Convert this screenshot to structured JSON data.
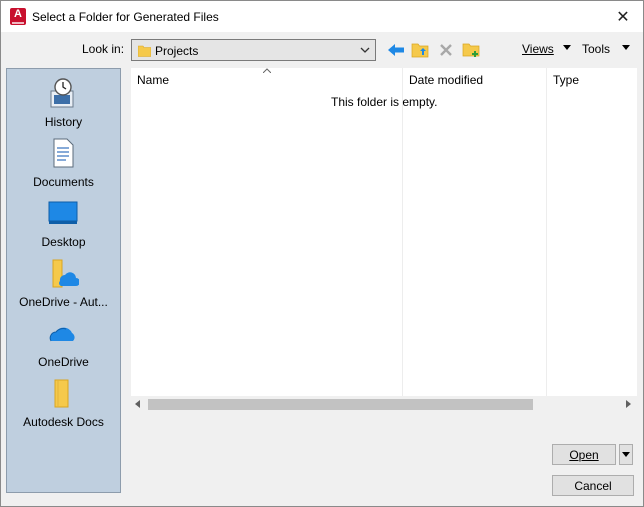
{
  "window": {
    "title": "Select a Folder for Generated Files",
    "close_glyph": "✕"
  },
  "toolbar": {
    "lookin_label": "Look in:",
    "lookin_value": "Projects",
    "views_label": "Views",
    "tools_label": "Tools",
    "icons": [
      "back-arrow-icon",
      "up-one-level-icon",
      "delete-icon",
      "create-new-folder-icon"
    ]
  },
  "places": {
    "items": [
      {
        "label": "History",
        "icon": "history-icon"
      },
      {
        "label": "Documents",
        "icon": "documents-icon"
      },
      {
        "label": "Desktop",
        "icon": "desktop-icon"
      },
      {
        "label": "OneDrive - Aut...",
        "icon": "onedrive-folder-icon"
      },
      {
        "label": "OneDrive",
        "icon": "onedrive-cloud-icon"
      },
      {
        "label": "Autodesk Docs",
        "icon": "autodesk-docs-folder-icon"
      }
    ]
  },
  "filelist": {
    "columns": [
      "Name",
      "Date modified",
      "Type"
    ],
    "empty_message": "This folder is empty."
  },
  "buttons": {
    "open_label": "Open",
    "cancel_label": "Cancel"
  },
  "colors": {
    "places_bg": "#bfcfdf",
    "accent_blue": "#1e88e5",
    "folder_yellow": "#f5c94b",
    "app_red": "#c8102e"
  }
}
